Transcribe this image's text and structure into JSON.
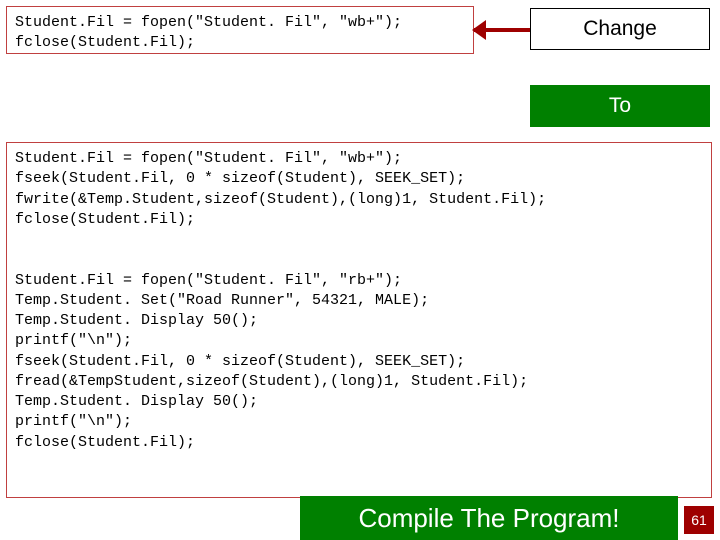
{
  "labels": {
    "change": "Change",
    "to": "To",
    "compile": "Compile The Program!"
  },
  "page_number": "61",
  "code_block_1": "Student.Fil = fopen(\"Student. Fil\", \"wb+\");\nfclose(Student.Fil);",
  "code_block_2": "Student.Fil = fopen(\"Student. Fil\", \"wb+\");\nfseek(Student.Fil, 0 * sizeof(Student), SEEK_SET);\nfwrite(&Temp.Student,sizeof(Student),(long)1, Student.Fil);\nfclose(Student.Fil);\n\n\nStudent.Fil = fopen(\"Student. Fil\", \"rb+\");\nTemp.Student. Set(\"Road Runner\", 54321, MALE);\nTemp.Student. Display 50();\nprintf(\"\\n\");\nfseek(Student.Fil, 0 * sizeof(Student), SEEK_SET);\nfread(&TempStudent,sizeof(Student),(long)1, Student.Fil);\nTemp.Student. Display 50();\nprintf(\"\\n\");\nfclose(Student.Fil);"
}
